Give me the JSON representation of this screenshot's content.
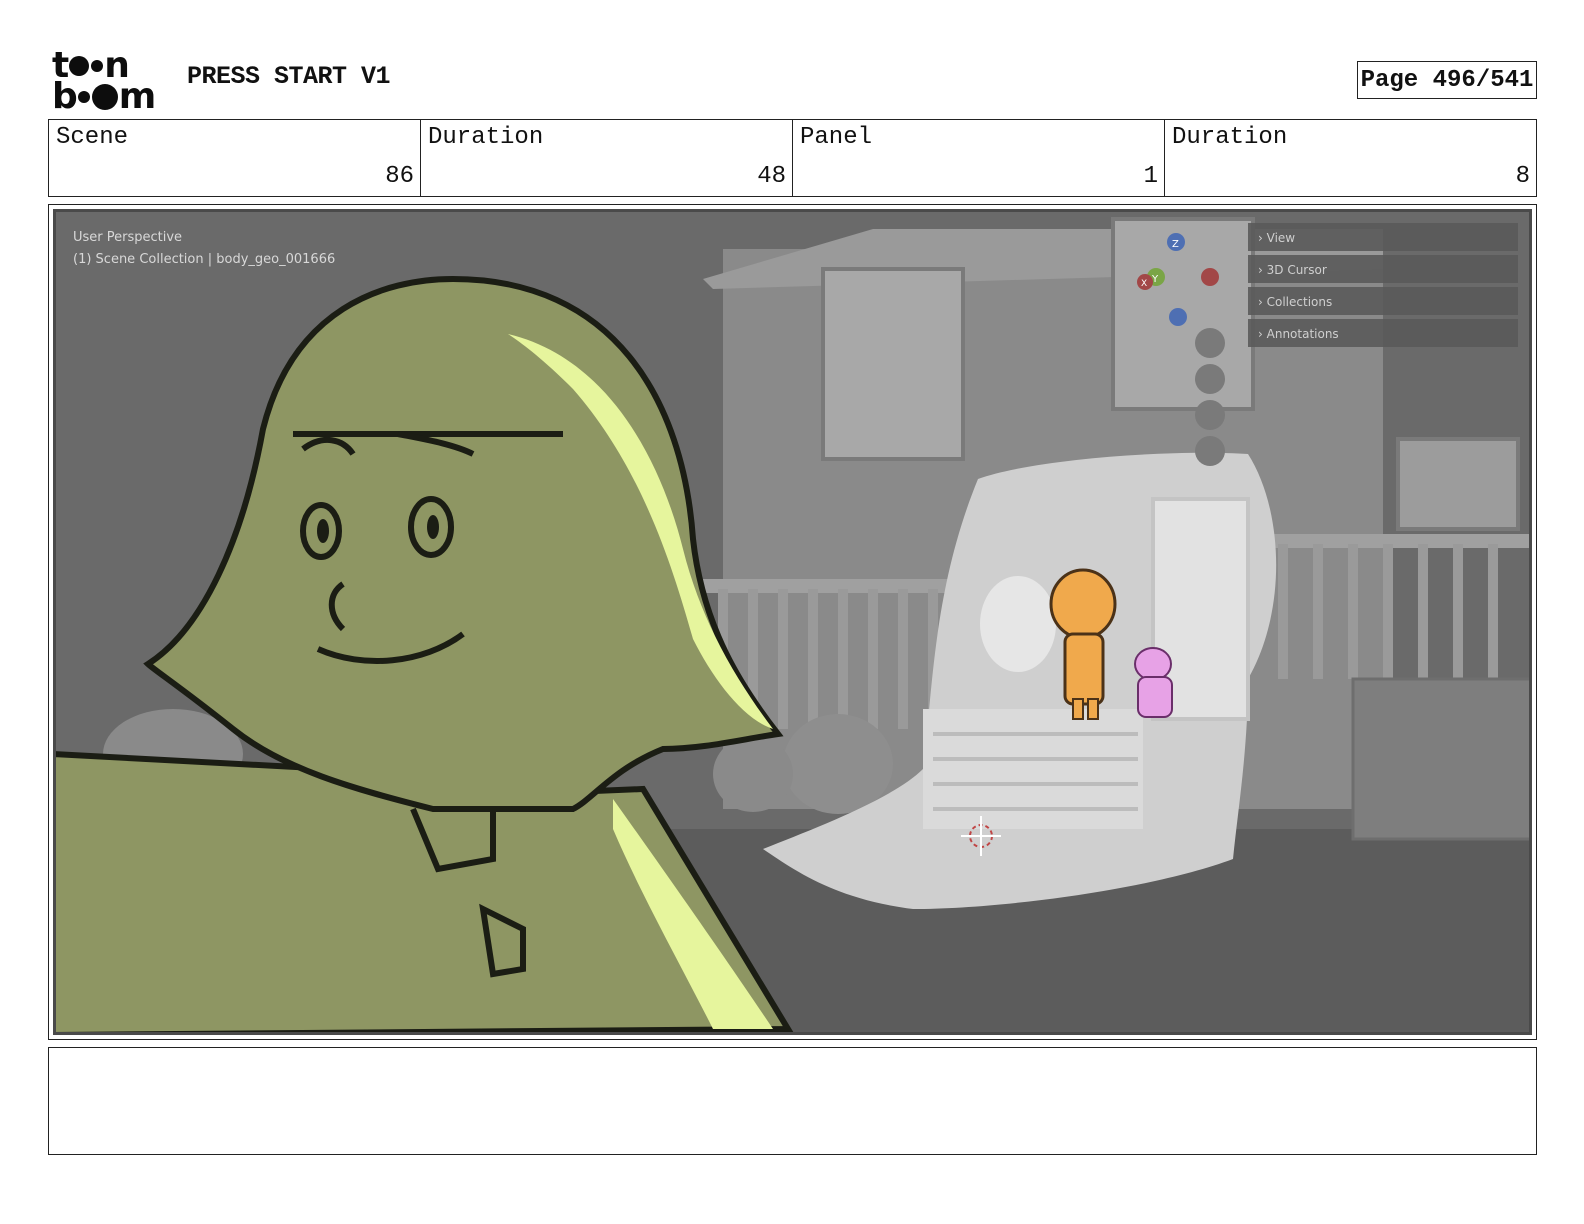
{
  "header": {
    "logo_top": "toon",
    "logo_bottom": "boom",
    "project_title": "PRESS START V1",
    "page_label": "Page 496/541"
  },
  "info": {
    "scene_label": "Scene",
    "scene_value": "86",
    "scene_duration_label": "Duration",
    "scene_duration_value": "48",
    "panel_label": "Panel",
    "panel_value": "1",
    "panel_duration_label": "Duration",
    "panel_duration_value": "8"
  },
  "viewport": {
    "perspective_label": "User Perspective",
    "collection_label": "(1) Scene Collection | body_geo_001666",
    "side_menu": [
      "View",
      "3D Cursor",
      "Collections",
      "Annotations"
    ],
    "gizmo_axes": [
      "Z",
      "Y",
      "X"
    ]
  },
  "notes": {
    "text": ""
  },
  "colors": {
    "girl_skin": "#8e9663",
    "girl_highlight": "#e6f59d",
    "boy": "#f0a94c",
    "dog": "#e7a2e6",
    "background": "#6b6b6b"
  }
}
